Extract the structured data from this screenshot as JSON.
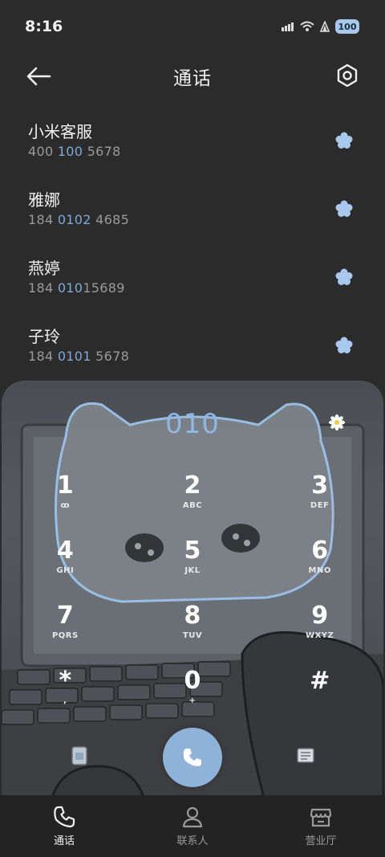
{
  "status_bar": {
    "time": "8:16",
    "battery": "100",
    "icons": [
      "data-speed-icon",
      "wifi-icon",
      "signal-icon",
      "battery-icon"
    ]
  },
  "header": {
    "title": "通话"
  },
  "contacts": [
    {
      "name": "小米客服",
      "number_pre": "400 ",
      "number_match": "100",
      "number_post": " 5678"
    },
    {
      "name": "雅娜",
      "number_pre": "184 ",
      "number_match": "0102",
      "number_post": " 4685"
    },
    {
      "name": "燕婷",
      "number_pre": "184 ",
      "number_match": "010",
      "number_post": "15689"
    },
    {
      "name": "子玲",
      "number_pre": "184 ",
      "number_match": "0101",
      "number_post": " 5678"
    }
  ],
  "dialer": {
    "input_value": "010",
    "keys": [
      {
        "digit": "1",
        "letters": "ꝏ"
      },
      {
        "digit": "2",
        "letters": "ABC"
      },
      {
        "digit": "3",
        "letters": "DEF"
      },
      {
        "digit": "4",
        "letters": "GHI"
      },
      {
        "digit": "5",
        "letters": "JKL"
      },
      {
        "digit": "6",
        "letters": "MNO"
      },
      {
        "digit": "7",
        "letters": "PQRS"
      },
      {
        "digit": "8",
        "letters": "TUV"
      },
      {
        "digit": "9",
        "letters": "WXYZ"
      },
      {
        "digit": "*",
        "letters": ","
      },
      {
        "digit": "0",
        "letters": "+"
      },
      {
        "digit": "#",
        "letters": ""
      }
    ]
  },
  "bottom_nav": {
    "items": [
      {
        "label": "通话",
        "active": true
      },
      {
        "label": "联系人",
        "active": false
      },
      {
        "label": "营业厅",
        "active": false
      }
    ]
  },
  "colors": {
    "background": "#2b2b2b",
    "accent": "#8fb2d8",
    "highlight": "#7fa9d6",
    "nav_background": "#232323"
  }
}
